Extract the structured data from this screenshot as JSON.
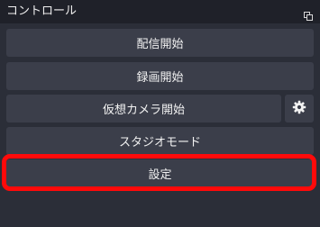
{
  "panel": {
    "title": "コントロール",
    "float_icon": "undock-icon"
  },
  "buttons": {
    "start_streaming": "配信開始",
    "start_recording": "録画開始",
    "start_virtual_camera": "仮想カメラ開始",
    "virtual_camera_settings_icon": "gear-icon",
    "studio_mode": "スタジオモード",
    "settings": "設定"
  },
  "annotation": {
    "highlight_color": "#ff0a0a"
  }
}
